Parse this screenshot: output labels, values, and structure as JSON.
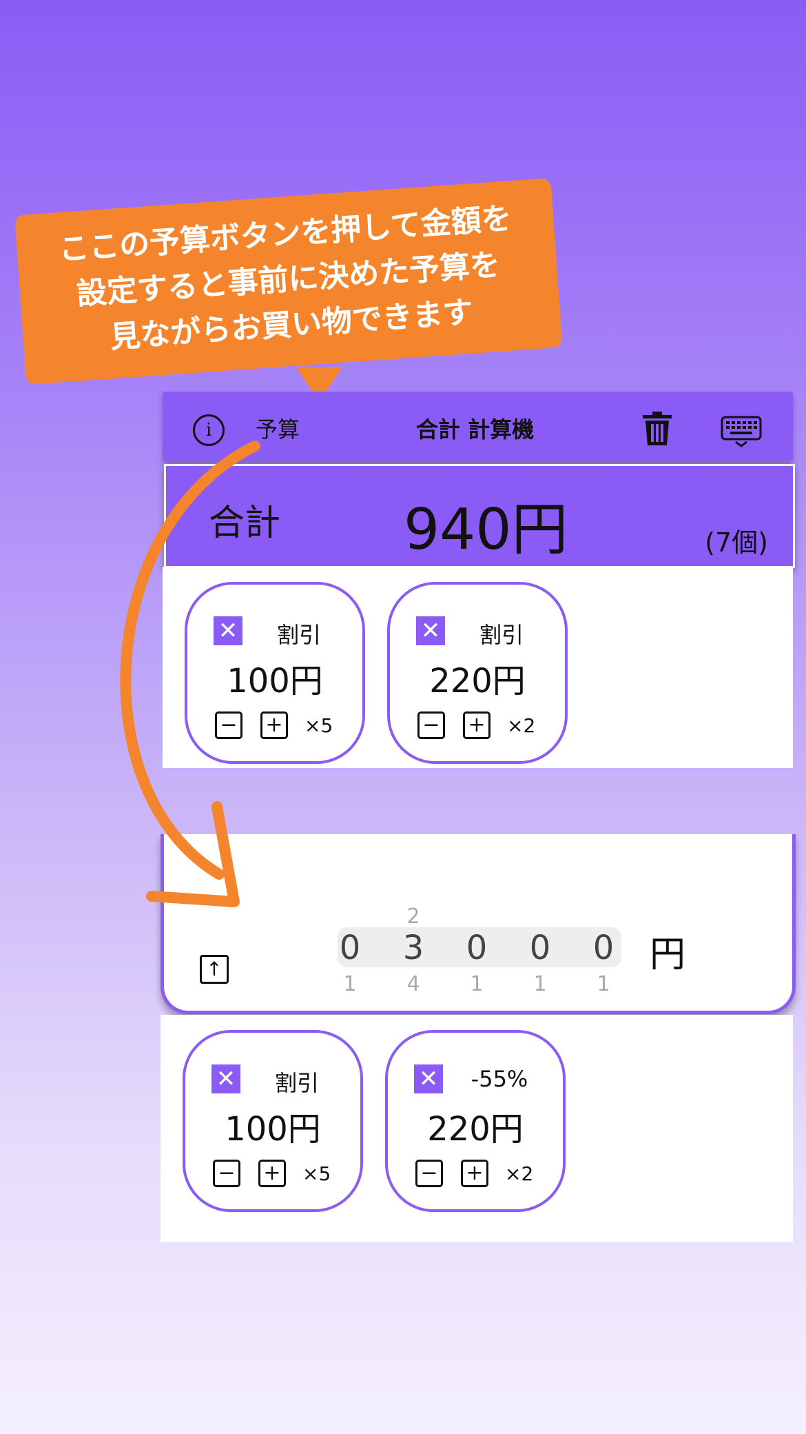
{
  "callout": {
    "line1": "ここの予算ボタンを押して金額を",
    "line2": "設定すると事前に決めた予算を",
    "line3": "見ながらお買い物できます"
  },
  "header": {
    "info_icon": "info-circle-icon",
    "info_glyph": "i",
    "budget_label": "予算",
    "title": "合計 計算機",
    "trash_icon": "trash-icon",
    "keyboard_icon": "keyboard-hide-icon"
  },
  "total": {
    "label": "合計",
    "amount": "940円",
    "count": "(7個)"
  },
  "items_top": [
    {
      "remove": "✕",
      "discount": "割引",
      "price": "100円",
      "minus": "−",
      "plus": "+",
      "qty": "×5"
    },
    {
      "remove": "✕",
      "discount": "割引",
      "price": "220円",
      "minus": "−",
      "plus": "+",
      "qty": "×2"
    }
  ],
  "budget_picker": {
    "collapse_icon": "arrow-up-square-icon",
    "collapse_glyph": "↑",
    "digits": [
      "0",
      "3",
      "0",
      "0",
      "0"
    ],
    "above": [
      "",
      "2",
      "",
      "",
      ""
    ],
    "below": [
      "1",
      "4",
      "1",
      "1",
      "1"
    ],
    "unit": "円"
  },
  "items_bottom": [
    {
      "remove": "✕",
      "discount": "割引",
      "price": "100円",
      "minus": "−",
      "plus": "+",
      "qty": "×5"
    },
    {
      "remove": "✕",
      "discount": "-55%",
      "price": "220円",
      "minus": "−",
      "plus": "+",
      "qty": "×2"
    }
  ],
  "colors": {
    "accent": "#8b5cf5",
    "callout": "#f5852d",
    "arrow": "#f5852d"
  }
}
